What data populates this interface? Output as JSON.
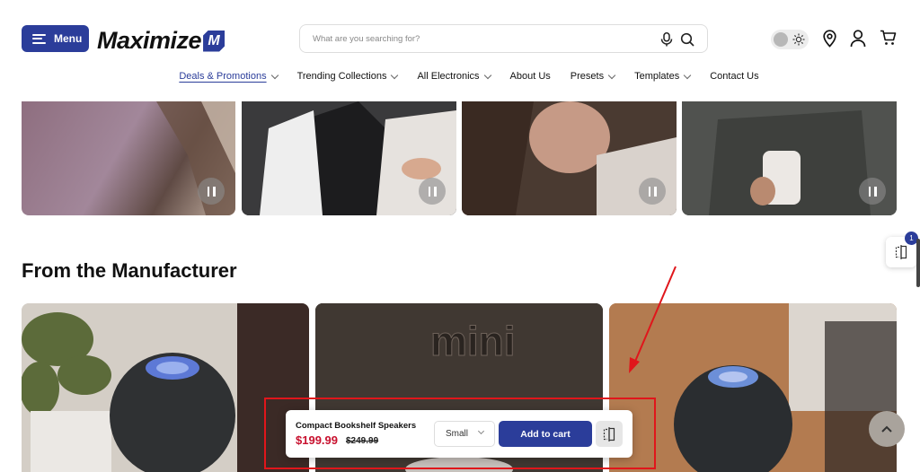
{
  "header": {
    "menu_label": "Menu",
    "logo_text": "Maximize",
    "logo_mark": "M",
    "search_placeholder": "What are you searching for?",
    "icons": [
      "menu-icon",
      "microphone-icon",
      "search-icon",
      "sun-icon",
      "location-icon",
      "user-icon",
      "cart-icon"
    ]
  },
  "nav": {
    "items": [
      {
        "label": "Deals & Promotions",
        "dropdown": true,
        "active": true
      },
      {
        "label": "Trending Collections",
        "dropdown": true
      },
      {
        "label": "All Electronics",
        "dropdown": true
      },
      {
        "label": "About Us",
        "dropdown": false
      },
      {
        "label": "Presets",
        "dropdown": true
      },
      {
        "label": "Templates",
        "dropdown": true
      },
      {
        "label": "Contact Us",
        "dropdown": false
      }
    ]
  },
  "section": {
    "title": "From the Manufacturer",
    "panel_text": "mini"
  },
  "sticky_bar": {
    "product_name": "Compact Bookshelf Speakers",
    "price": "$199.99",
    "old_price": "$249.99",
    "size_value": "Small",
    "add_to_cart_label": "Add to cart"
  },
  "compare": {
    "count": "1"
  },
  "colors": {
    "brand": "#2b3d9a",
    "sale_price": "#c8102e",
    "annotation": "#e0161b"
  }
}
